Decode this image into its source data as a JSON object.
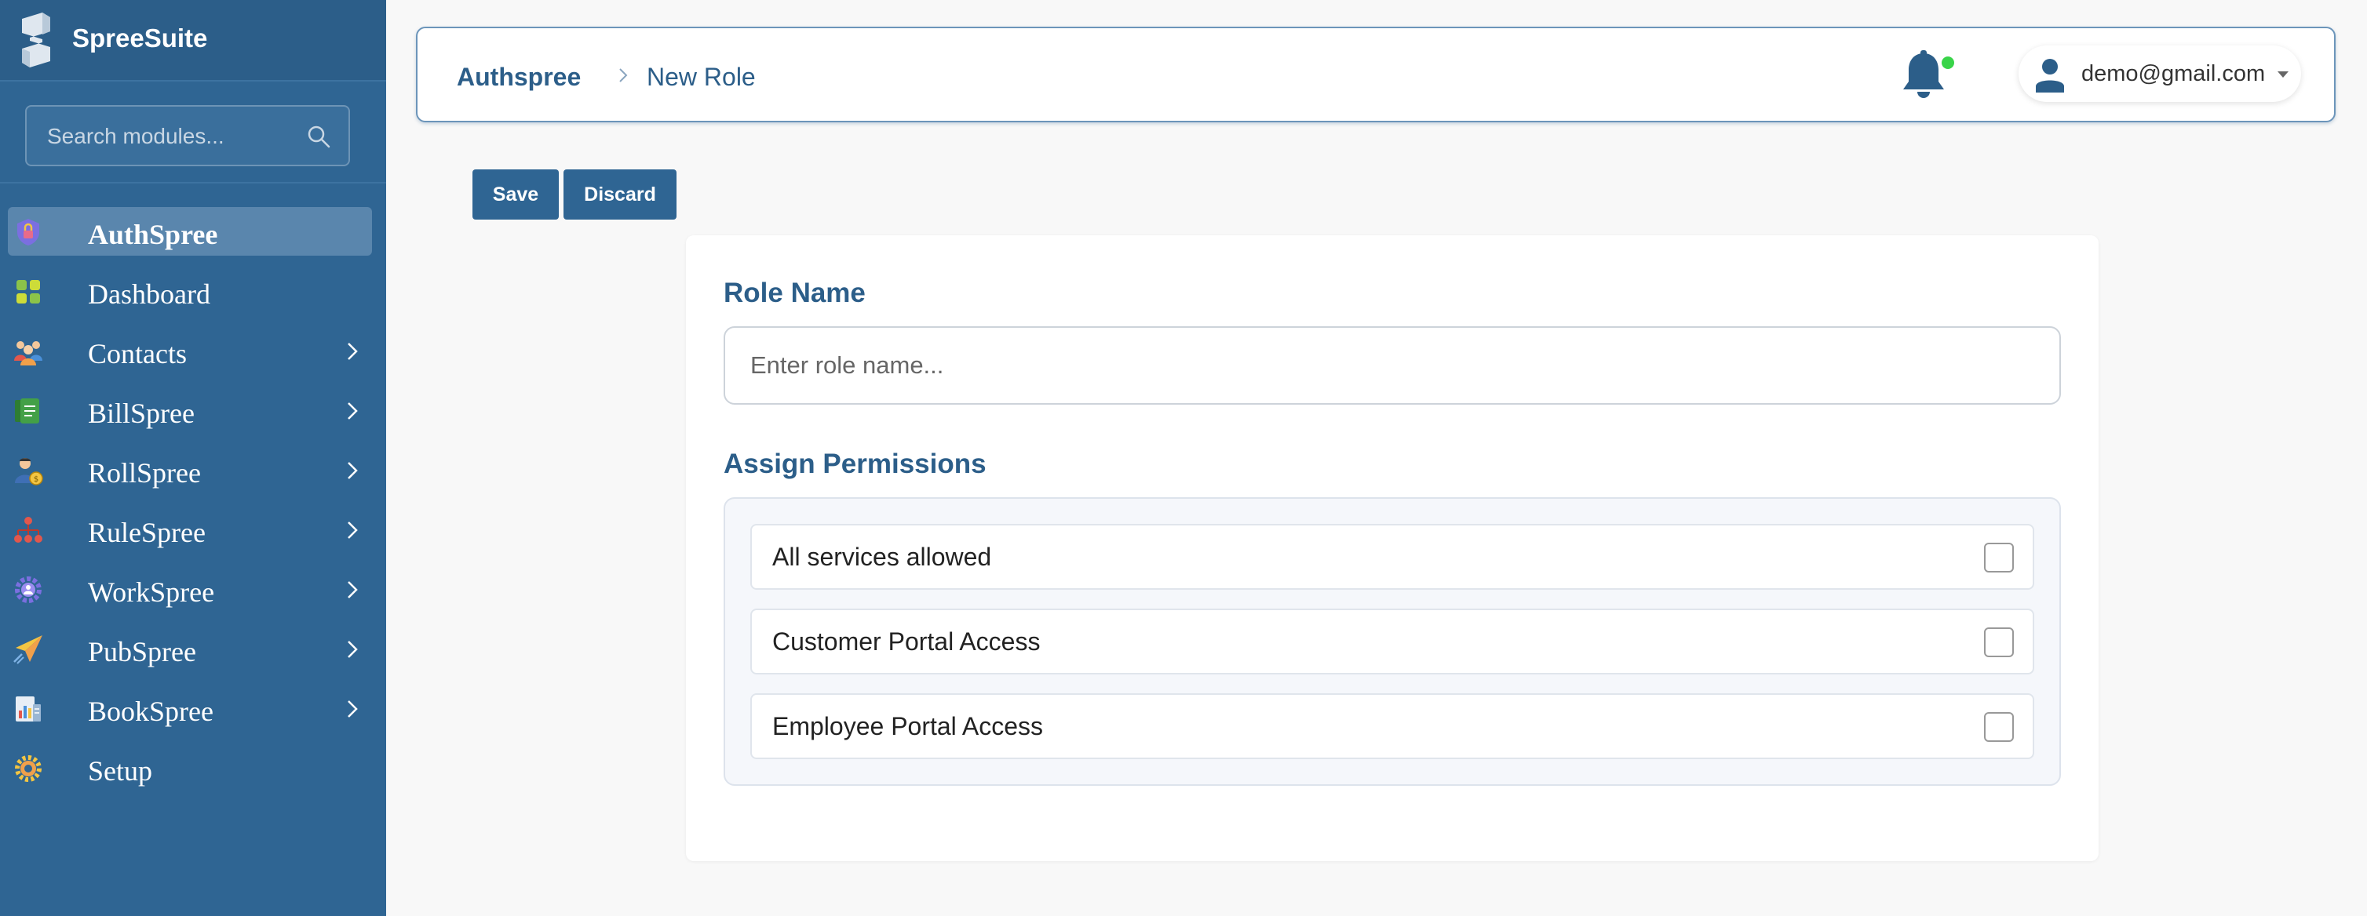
{
  "app": {
    "name": "SpreeSuite"
  },
  "sidebar": {
    "search_placeholder": "Search modules...",
    "items": [
      {
        "label": "AuthSpree",
        "icon": "shield-lock-icon",
        "active": true,
        "has_children": false
      },
      {
        "label": "Dashboard",
        "icon": "dashboard-grid-icon",
        "active": false,
        "has_children": false
      },
      {
        "label": "Contacts",
        "icon": "people-group-icon",
        "active": false,
        "has_children": true
      },
      {
        "label": "BillSpree",
        "icon": "bill-document-icon",
        "active": false,
        "has_children": true
      },
      {
        "label": "RollSpree",
        "icon": "payroll-person-icon",
        "active": false,
        "has_children": true
      },
      {
        "label": "RuleSpree",
        "icon": "org-hierarchy-icon",
        "active": false,
        "has_children": true
      },
      {
        "label": "WorkSpree",
        "icon": "workflow-gear-icon",
        "active": false,
        "has_children": true
      },
      {
        "label": "PubSpree",
        "icon": "paper-plane-icon",
        "active": false,
        "has_children": true
      },
      {
        "label": "BookSpree",
        "icon": "ledger-chart-icon",
        "active": false,
        "has_children": true
      },
      {
        "label": "Setup",
        "icon": "settings-gear-icon",
        "active": false,
        "has_children": false
      }
    ]
  },
  "header": {
    "breadcrumb_root": "Authspree",
    "breadcrumb_current": "New Role",
    "notification_status": "online",
    "user_email": "demo@gmail.com"
  },
  "toolbar": {
    "save_label": "Save",
    "discard_label": "Discard"
  },
  "form": {
    "role_name_title": "Role Name",
    "role_name_placeholder": "Enter role name...",
    "role_name_value": "",
    "permissions_title": "Assign Permissions",
    "permissions": [
      {
        "label": "All services allowed",
        "checked": false
      },
      {
        "label": "Customer Portal Access",
        "checked": false
      },
      {
        "label": "Employee Portal Access",
        "checked": false
      }
    ]
  },
  "colors": {
    "sidebar_bg": "#2f6593",
    "sidebar_active": "#5a86ad",
    "accent": "#2c5e89",
    "notification_dot": "#39d449",
    "page_bg": "#f8f8f8"
  }
}
